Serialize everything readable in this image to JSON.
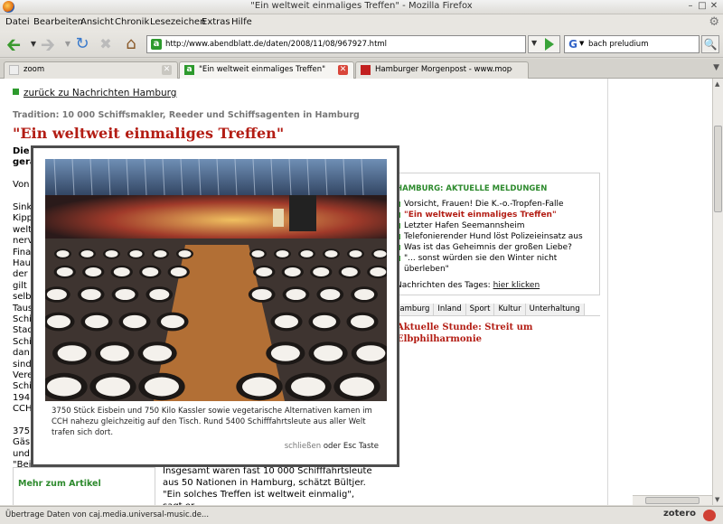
{
  "window": {
    "title": "\"Ein weltweit einmaliges Treffen\" - Mozilla Firefox"
  },
  "menu": [
    "Datei",
    "Bearbeiten",
    "Ansicht",
    "Chronik",
    "Lesezeichen",
    "Extras",
    "Hilfe"
  ],
  "toolbar": {
    "url": "http://www.abendblatt.de/daten/2008/11/08/967927.html",
    "search_engine_icon": "google-icon",
    "search_value": "bach preludium"
  },
  "tabs": [
    {
      "label": "zoom",
      "active": false
    },
    {
      "label": "\"Ein weltweit einmaliges Treffen\"",
      "active": true
    },
    {
      "label": "Hamburger Morgenpost - www.mopo.de...",
      "active": false
    }
  ],
  "article": {
    "back_link": "zurück zu Nachrichten Hamburg",
    "kicker": "Tradition: 10 000 Schiffsmakler, Reeder und Schiffsagenten in Hamburg",
    "headline": "\"Ein weltweit einmaliges Treffen\"",
    "peek_lines": [
      "Die",
      "gera",
      "",
      "Von",
      "",
      "Sinkl",
      "Kipp",
      "welt",
      "nerv",
      "Fina",
      "Hau",
      "der",
      "gilt",
      "selb",
      "Taus",
      "Schi",
      "Stad",
      "Schi",
      "dan",
      "sind",
      "Vere",
      "Schi",
      "194",
      "CCH",
      "",
      "375",
      "Gäs",
      "und",
      "\"Bei"
    ],
    "body_text": "Insgesamt waren fast 10 000 Schifffahrtsleute aus 50 Nationen in Hamburg, schätzt Bültjer. \"Ein solches Treffen ist weltweit einmalig\", sagt er."
  },
  "sidebar": {
    "header": "HAMBURG: AKTUELLE MELDUNGEN",
    "items": [
      {
        "text": "Vorsicht, Frauen! Die K.-o.-Tropfen-Falle",
        "highlight": false
      },
      {
        "text": "\"Ein weltweit einmaliges Treffen\"",
        "highlight": true
      },
      {
        "text": "Letzter Hafen Seemannsheim",
        "highlight": false
      },
      {
        "text": "Telefonierender Hund löst Polizeieinsatz aus",
        "highlight": false
      },
      {
        "text": "Was ist das Geheimnis der großen Liebe?",
        "highlight": false
      },
      {
        "text": "\"... sonst würden sie den Winter nicht überleben\"",
        "highlight": false
      }
    ],
    "footer_label": "Nachrichten des Tages:",
    "footer_link": "hier klicken",
    "rubrics": [
      "Hamburg",
      "Inland",
      "Sport",
      "Kultur",
      "Unterhaltung"
    ],
    "aktuell": "Aktuelle Stunde: Streit um Elbphilharmonie",
    "mehr_header": "Mehr zum Artikel"
  },
  "lightbox": {
    "caption": "3750 Stück Eisbein und 750 Kilo Kassler sowie vegetarische Alternativen kamen im CCH nahezu gleichzeitig auf den Tisch. Rund 5400 Schifffahrtsleute aus aller Welt trafen sich dort.",
    "close_link": "schließen",
    "close_hint": "oder Esc Taste"
  },
  "status": {
    "text": "Übertrage Daten von caj.media.universal-music.de...",
    "zotero": "zotero"
  }
}
